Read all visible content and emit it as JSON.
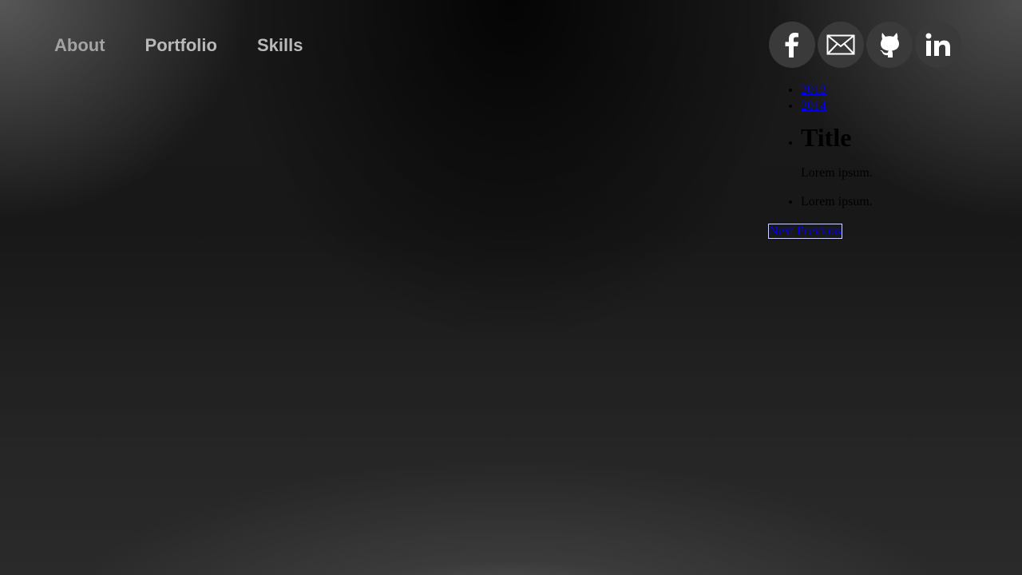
{
  "nav": {
    "items": [
      {
        "label": "About"
      },
      {
        "label": "Portfolio"
      },
      {
        "label": "Skills"
      }
    ]
  },
  "social": [
    {
      "icon": "facebook-icon"
    },
    {
      "icon": "mail-icon"
    },
    {
      "icon": "github-icon"
    },
    {
      "icon": "linkedin-icon"
    }
  ],
  "archive": {
    "years": [
      "2013",
      "2014"
    ]
  },
  "posts": {
    "title": "Title",
    "body": "Lorem ipsum.",
    "second": "Lorem ipsum."
  },
  "pager": {
    "next": "Next",
    "previous": "Previous"
  },
  "colors": {
    "nav_text": "#b9b9b9",
    "social_bg": "#3a3a3a",
    "link": "#0000ee"
  }
}
